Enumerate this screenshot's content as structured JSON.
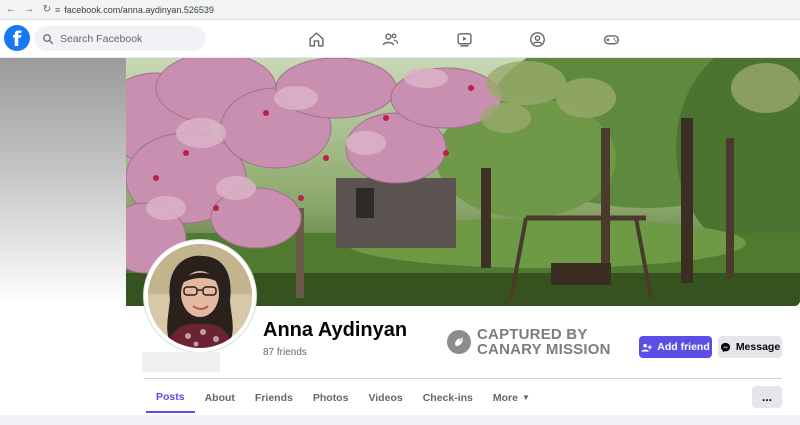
{
  "browser": {
    "url": "facebook.com/anna.aydinyan.526539",
    "icons": [
      "back-arrow-icon",
      "forward-arrow-icon",
      "reload-icon",
      "site-settings-icon"
    ]
  },
  "header": {
    "logo_letter": "f",
    "search_placeholder": "Search Facebook",
    "nav_icons": [
      "home-icon",
      "friends-icon",
      "watch-icon",
      "groups-icon",
      "gaming-icon"
    ]
  },
  "profile": {
    "name": "Anna Aydinyan",
    "friends": "87 friends"
  },
  "stamp": {
    "line1": "CAPTURED BY",
    "line2": "CANARY MISSION"
  },
  "actions": {
    "add_friend": "Add friend",
    "message": "Message",
    "more": "..."
  },
  "tabs": [
    {
      "label": "Posts",
      "active": true
    },
    {
      "label": "About"
    },
    {
      "label": "Friends"
    },
    {
      "label": "Photos"
    },
    {
      "label": "Videos"
    },
    {
      "label": "Check-ins"
    },
    {
      "label": "More"
    }
  ],
  "colors": {
    "fb_blue": "#1877f2",
    "accent": "#5b4ee6",
    "muted_text": "#65676b"
  }
}
